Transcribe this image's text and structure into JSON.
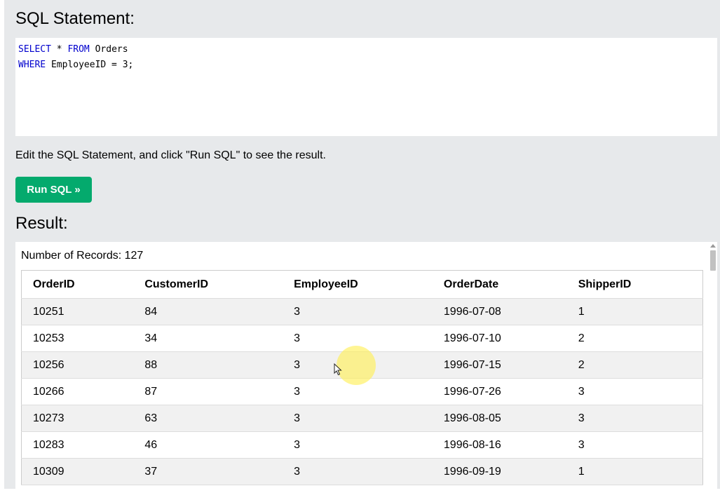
{
  "sql_heading": "SQL Statement:",
  "editor": {
    "line1": {
      "kw1": "SELECT",
      "rest1": " * ",
      "kw2": "FROM",
      "rest2": " Orders"
    },
    "line2": {
      "kw1": "WHERE",
      "rest1": " EmployeeID = 3;"
    }
  },
  "instruction": "Edit the SQL Statement, and click \"Run SQL\" to see the result.",
  "run_button": "Run SQL »",
  "result_heading": "Result:",
  "records_text": "Number of Records: 127",
  "table": {
    "headers": [
      "OrderID",
      "CustomerID",
      "EmployeeID",
      "OrderDate",
      "ShipperID"
    ],
    "rows": [
      [
        "10251",
        "84",
        "3",
        "1996-07-08",
        "1"
      ],
      [
        "10253",
        "34",
        "3",
        "1996-07-10",
        "2"
      ],
      [
        "10256",
        "88",
        "3",
        "1996-07-15",
        "2"
      ],
      [
        "10266",
        "87",
        "3",
        "1996-07-26",
        "3"
      ],
      [
        "10273",
        "63",
        "3",
        "1996-08-05",
        "3"
      ],
      [
        "10283",
        "46",
        "3",
        "1996-08-16",
        "3"
      ],
      [
        "10309",
        "37",
        "3",
        "1996-09-19",
        "1"
      ]
    ]
  },
  "colors": {
    "button": "#04aa6d",
    "keyword": "#0000cd",
    "panel_bg": "#e7e9eb",
    "row_alt": "#f1f1f1",
    "click_highlight": "#fff05a"
  },
  "icons": {
    "cursor": "arrow-pointer-icon",
    "scroll_up": "triangle-up-icon"
  }
}
